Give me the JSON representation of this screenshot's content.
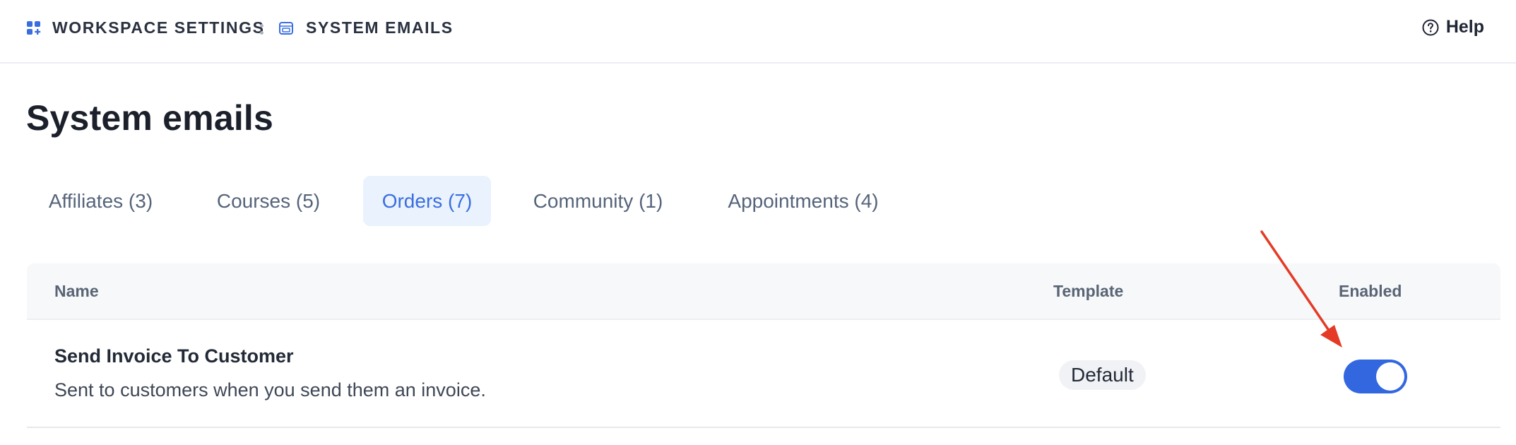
{
  "breadcrumb": {
    "workspace_label": "WORKSPACE SETTINGS",
    "current_label": "SYSTEM EMAILS",
    "workspace_icon": "grid-plus-icon",
    "current_icon": "email-window-icon"
  },
  "header": {
    "help_label": "Help",
    "help_icon": "question-circle-icon"
  },
  "page": {
    "title": "System emails"
  },
  "tabs": [
    {
      "label": "Affiliates (3)",
      "active": false
    },
    {
      "label": "Courses (5)",
      "active": false
    },
    {
      "label": "Orders (7)",
      "active": true
    },
    {
      "label": "Community (1)",
      "active": false
    },
    {
      "label": "Appointments (4)",
      "active": false
    }
  ],
  "table": {
    "columns": {
      "name": "Name",
      "template": "Template",
      "enabled": "Enabled"
    },
    "rows": [
      {
        "title": "Send Invoice To Customer",
        "description": "Sent to customers when you send them an invoice.",
        "template": "Default",
        "enabled": true
      }
    ]
  },
  "colors": {
    "accent": "#3267e0",
    "active_tab_bg": "#e9f2fd",
    "annotation_arrow": "#e53a25"
  }
}
